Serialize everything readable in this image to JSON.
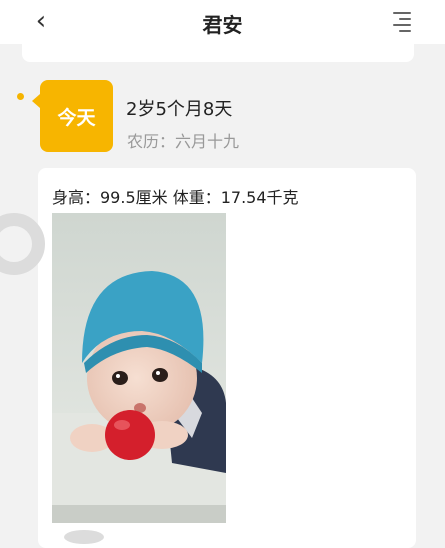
{
  "header": {
    "back_icon": "chevron-left-icon",
    "title": "君安",
    "menu_icon": "list-menu-icon"
  },
  "entry": {
    "day_label": "今天",
    "age": "2岁5个月8天",
    "lunar_date": "农历：六月十九",
    "stats": "身高：99.5厘米 体重：17.54千克",
    "photo": "baby-photo"
  },
  "colors": {
    "accent": "#f7b500",
    "card": "#ffffff",
    "background": "#f2f2f2"
  }
}
